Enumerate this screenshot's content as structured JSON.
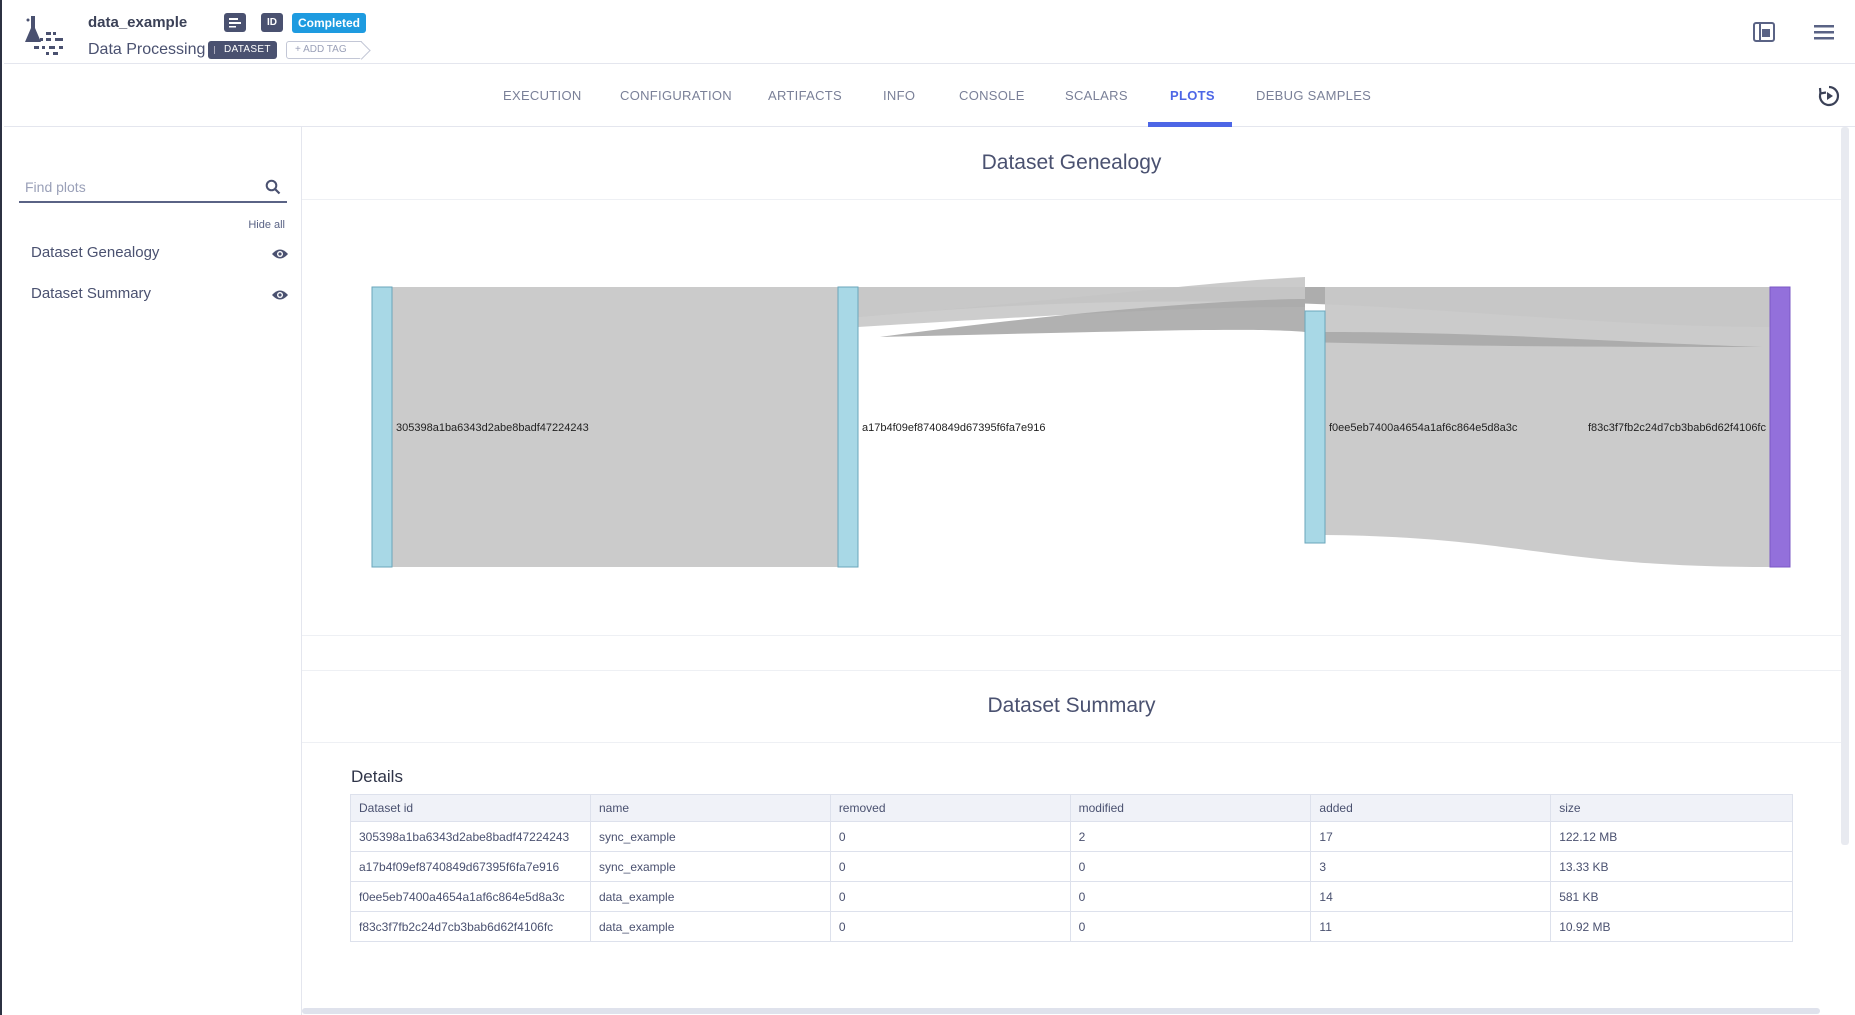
{
  "header": {
    "task_name": "data_example",
    "project_name": "Data Processing",
    "id_badge": "ID",
    "status": "Completed",
    "tag": "DATASET",
    "add_tag": "+ ADD TAG"
  },
  "tabs": [
    {
      "label": "EXECUTION"
    },
    {
      "label": "CONFIGURATION"
    },
    {
      "label": "ARTIFACTS"
    },
    {
      "label": "INFO"
    },
    {
      "label": "CONSOLE"
    },
    {
      "label": "SCALARS"
    },
    {
      "label": "PLOTS",
      "active": true
    },
    {
      "label": "DEBUG SAMPLES"
    }
  ],
  "sidebar": {
    "search_placeholder": "Find plots",
    "hide_all": "Hide all",
    "items": [
      {
        "label": "Dataset Genealogy"
      },
      {
        "label": "Dataset Summary"
      }
    ]
  },
  "genealogy": {
    "title": "Dataset Genealogy",
    "nodes": [
      "305398a1ba6343d2abe8badf47224243",
      "a17b4f09ef8740849d67395f6fa7e916",
      "f0ee5eb7400a4654a1af6c864e5d8a3c",
      "f83c3f7fb2c24d7cb3bab6d62f4106fc"
    ]
  },
  "summary": {
    "title": "Dataset Summary",
    "details_title": "Details",
    "columns": [
      "Dataset id",
      "name",
      "removed",
      "modified",
      "added",
      "size"
    ],
    "rows": [
      [
        "305398a1ba6343d2abe8badf47224243",
        "sync_example",
        "0",
        "2",
        "17",
        "122.12 MB"
      ],
      [
        "a17b4f09ef8740849d67395f6fa7e916",
        "sync_example",
        "0",
        "0",
        "3",
        "13.33 KB"
      ],
      [
        "f0ee5eb7400a4654a1af6c864e5d8a3c",
        "data_example",
        "0",
        "0",
        "14",
        "581 KB"
      ],
      [
        "f83c3f7fb2c24d7cb3bab6d62f4106fc",
        "data_example",
        "0",
        "0",
        "11",
        "10.92 MB"
      ]
    ]
  },
  "colors": {
    "accent": "#4d66e6",
    "status": "#1e9be0",
    "node": "#a8d8e6",
    "final_node": "#9370db",
    "link": "#c8c8c8"
  }
}
